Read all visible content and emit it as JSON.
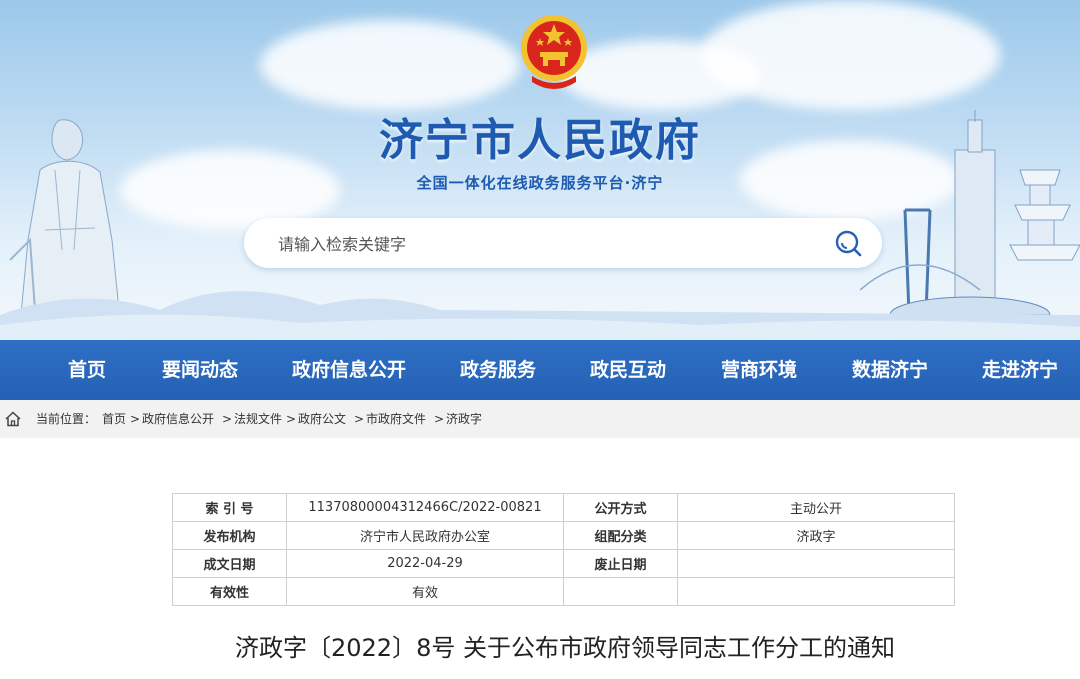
{
  "header": {
    "site_title": "济宁市人民政府",
    "site_subtitle": "全国一体化在线政务服务平台·济宁",
    "search_placeholder": "请输入检索关键字"
  },
  "nav": {
    "items": [
      "首页",
      "要闻动态",
      "政府信息公开",
      "政务服务",
      "政民互动",
      "营商环境",
      "数据济宁",
      "走进济宁"
    ]
  },
  "breadcrumb": {
    "prefix": "当前位置：",
    "items": [
      "首页",
      "政府信息公开",
      "法规文件",
      "政府公文",
      "市政府文件",
      "济政字"
    ],
    "separator": ">"
  },
  "info_table": {
    "rows": [
      {
        "k1": "索 引 号",
        "v1": "11370800004312466C/2022-00821",
        "k2": "公开方式",
        "v2": "主动公开"
      },
      {
        "k1": "发布机构",
        "v1": "济宁市人民政府办公室",
        "k2": "组配分类",
        "v2": "济政字"
      },
      {
        "k1": "成文日期",
        "v1": "2022-04-29",
        "k2": "废止日期",
        "v2": ""
      },
      {
        "k1": "有效性",
        "v1": "有效",
        "k2": "",
        "v2": ""
      }
    ]
  },
  "document": {
    "title": "济政字〔2022〕8号 关于公布市政府领导同志工作分工的通知"
  },
  "colors": {
    "brand_blue": "#1d5ab0",
    "nav_blue": "#2e6fc4",
    "emblem_red": "#d9261c",
    "emblem_gold": "#f2c230"
  }
}
